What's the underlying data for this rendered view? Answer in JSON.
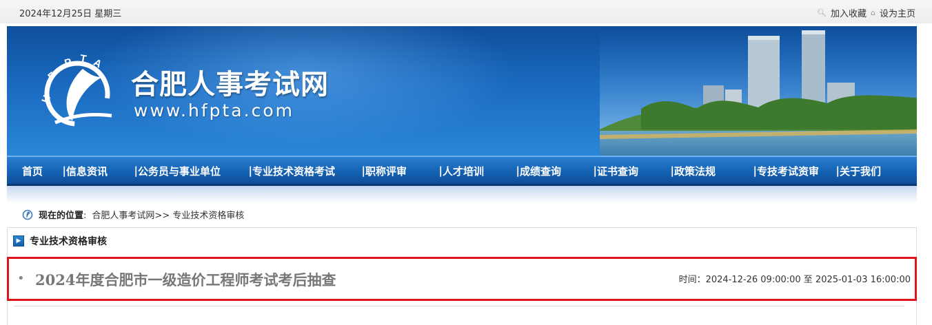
{
  "topbar": {
    "date": "2024年12月25日 星期三",
    "add_favorite": "加入收藏",
    "set_homepage": "设为主页"
  },
  "banner": {
    "logo_text": "HFPTA",
    "site_name": "合肥人事考试网",
    "site_url": "www.hfpta.com"
  },
  "nav": {
    "items": [
      {
        "label": "首页"
      },
      {
        "label": "信息资讯"
      },
      {
        "label": "公务员与事业单位"
      },
      {
        "label": "专业技术资格考试"
      },
      {
        "label": "职称评审"
      },
      {
        "label": "人才培训"
      },
      {
        "label": "成绩查询"
      },
      {
        "label": "证书查询"
      },
      {
        "label": "政策法规"
      },
      {
        "label": "专技考试资审"
      },
      {
        "label": "关于我们"
      }
    ],
    "separator": "|"
  },
  "breadcrumb": {
    "label": "现在的位置",
    "colon": ":",
    "path": "合肥人事考试网>> 专业技术资格审核"
  },
  "section": {
    "title": "专业技术资格审核"
  },
  "list": {
    "items": [
      {
        "title": "2024年度合肥市一级造价工程师考试考后抽查",
        "time": "时间：2024-12-26 09:00:00 至 2025-01-03 16:00:00"
      }
    ]
  },
  "colors": {
    "nav_blue": "#1562b4",
    "highlight_border": "#e0141b"
  }
}
